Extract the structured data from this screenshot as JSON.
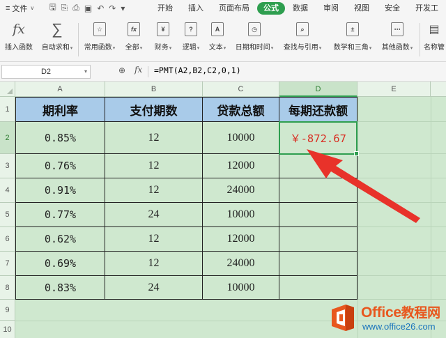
{
  "menubar": {
    "file_label": "文件",
    "tabs": [
      "开始",
      "插入",
      "页面布局",
      "公式",
      "数据",
      "审阅",
      "视图",
      "安全",
      "开发工"
    ],
    "active_tab": "公式"
  },
  "ribbon": {
    "items": [
      {
        "label": "插入函数",
        "icon": "fx-icon"
      },
      {
        "label": "自动求和",
        "icon": "sigma-icon",
        "dropdown": true
      },
      {
        "label": "常用函数",
        "icon": "star-function-icon",
        "dropdown": true
      },
      {
        "label": "全部",
        "icon": "fx-box-icon",
        "dropdown": true
      },
      {
        "label": "财务",
        "icon": "yen-book-icon",
        "dropdown": true
      },
      {
        "label": "逻辑",
        "icon": "question-book-icon",
        "dropdown": true
      },
      {
        "label": "文本",
        "icon": "a-book-icon",
        "dropdown": true
      },
      {
        "label": "日期和时间",
        "icon": "clock-book-icon",
        "dropdown": true
      },
      {
        "label": "查找与引用",
        "icon": "magnifier-book-icon",
        "dropdown": true
      },
      {
        "label": "数学和三角",
        "icon": "math-book-icon",
        "dropdown": true
      },
      {
        "label": "其他函数",
        "icon": "more-book-icon",
        "dropdown": true
      },
      {
        "label": "名称管",
        "icon": "name-manager-icon"
      }
    ]
  },
  "formula_bar": {
    "name_box": "D2",
    "fx_label": "fx",
    "formula": "=PMT(A2,B2,C2,0,1)"
  },
  "sheet": {
    "columns": [
      "A",
      "B",
      "C",
      "D",
      "E"
    ],
    "selected_column": "D",
    "rows": [
      "1",
      "2",
      "3",
      "4",
      "5",
      "6",
      "7",
      "8",
      "9",
      "10"
    ],
    "selected_row": "2",
    "headers": [
      "期利率",
      "支付期数",
      "贷款总额",
      "每期还款额"
    ],
    "data": [
      [
        "0.85%",
        "12",
        "10000",
        "￥-872.67"
      ],
      [
        "0.76%",
        "12",
        "12000",
        ""
      ],
      [
        "0.91%",
        "12",
        "24000",
        ""
      ],
      [
        "0.77%",
        "24",
        "10000",
        ""
      ],
      [
        "0.62%",
        "12",
        "12000",
        ""
      ],
      [
        "0.69%",
        "12",
        "24000",
        ""
      ],
      [
        "0.83%",
        "24",
        "10000",
        ""
      ]
    ],
    "result_color": "#d93025",
    "header_fill": "#a9cbe9",
    "sheet_background": "#cfe8cf",
    "selection_color": "#2e9e4f"
  },
  "watermark": {
    "title_latin": "Office",
    "title_cn": "教程网",
    "url": "www.office26.com"
  }
}
